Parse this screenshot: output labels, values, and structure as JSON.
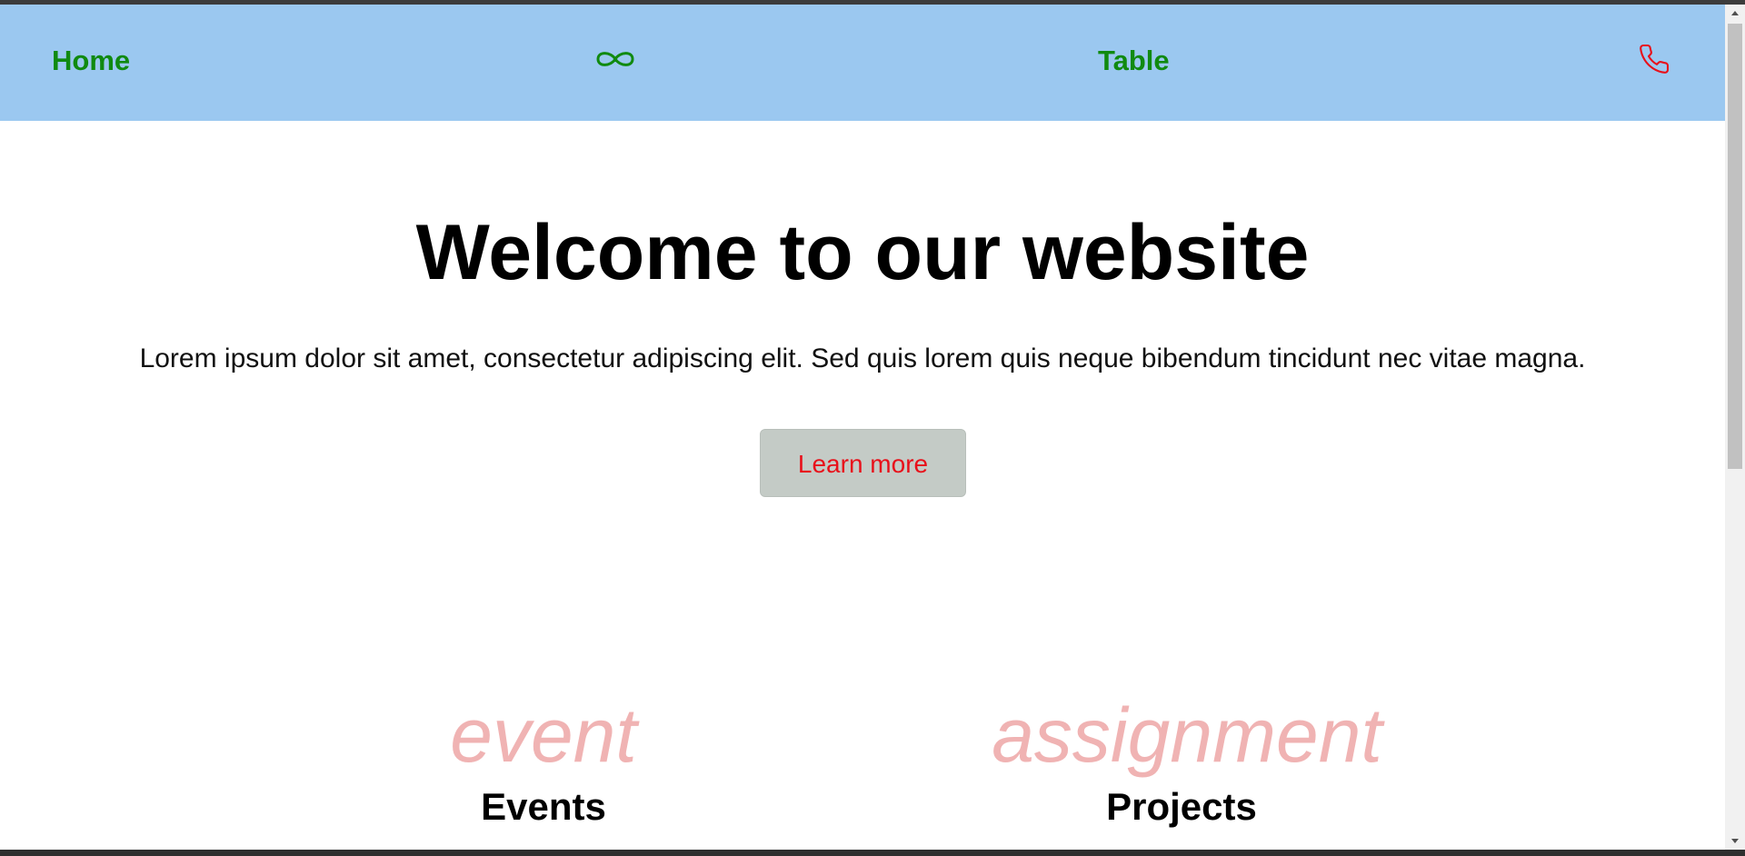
{
  "navbar": {
    "home_label": "Home",
    "table_label": "Table",
    "colors": {
      "background": "#9bc8f0",
      "link": "#108a10",
      "phone_icon": "#e8101a"
    },
    "icons": [
      "infinity-icon",
      "phone-icon"
    ]
  },
  "hero": {
    "title": "Welcome to our website",
    "text": "Lorem ipsum dolor sit amet, consectetur adipiscing elit. Sed quis lorem quis neque bibendum tincidunt nec vitae magna.",
    "button_label": "Learn more",
    "button_colors": {
      "background": "#c4cbc6",
      "text": "#e8101a"
    }
  },
  "features": [
    {
      "icon_text": "event",
      "title": "Events"
    },
    {
      "icon_text": "assignment",
      "title": "Projects"
    }
  ],
  "colors": {
    "feature_icon": "#f0b3b3"
  }
}
